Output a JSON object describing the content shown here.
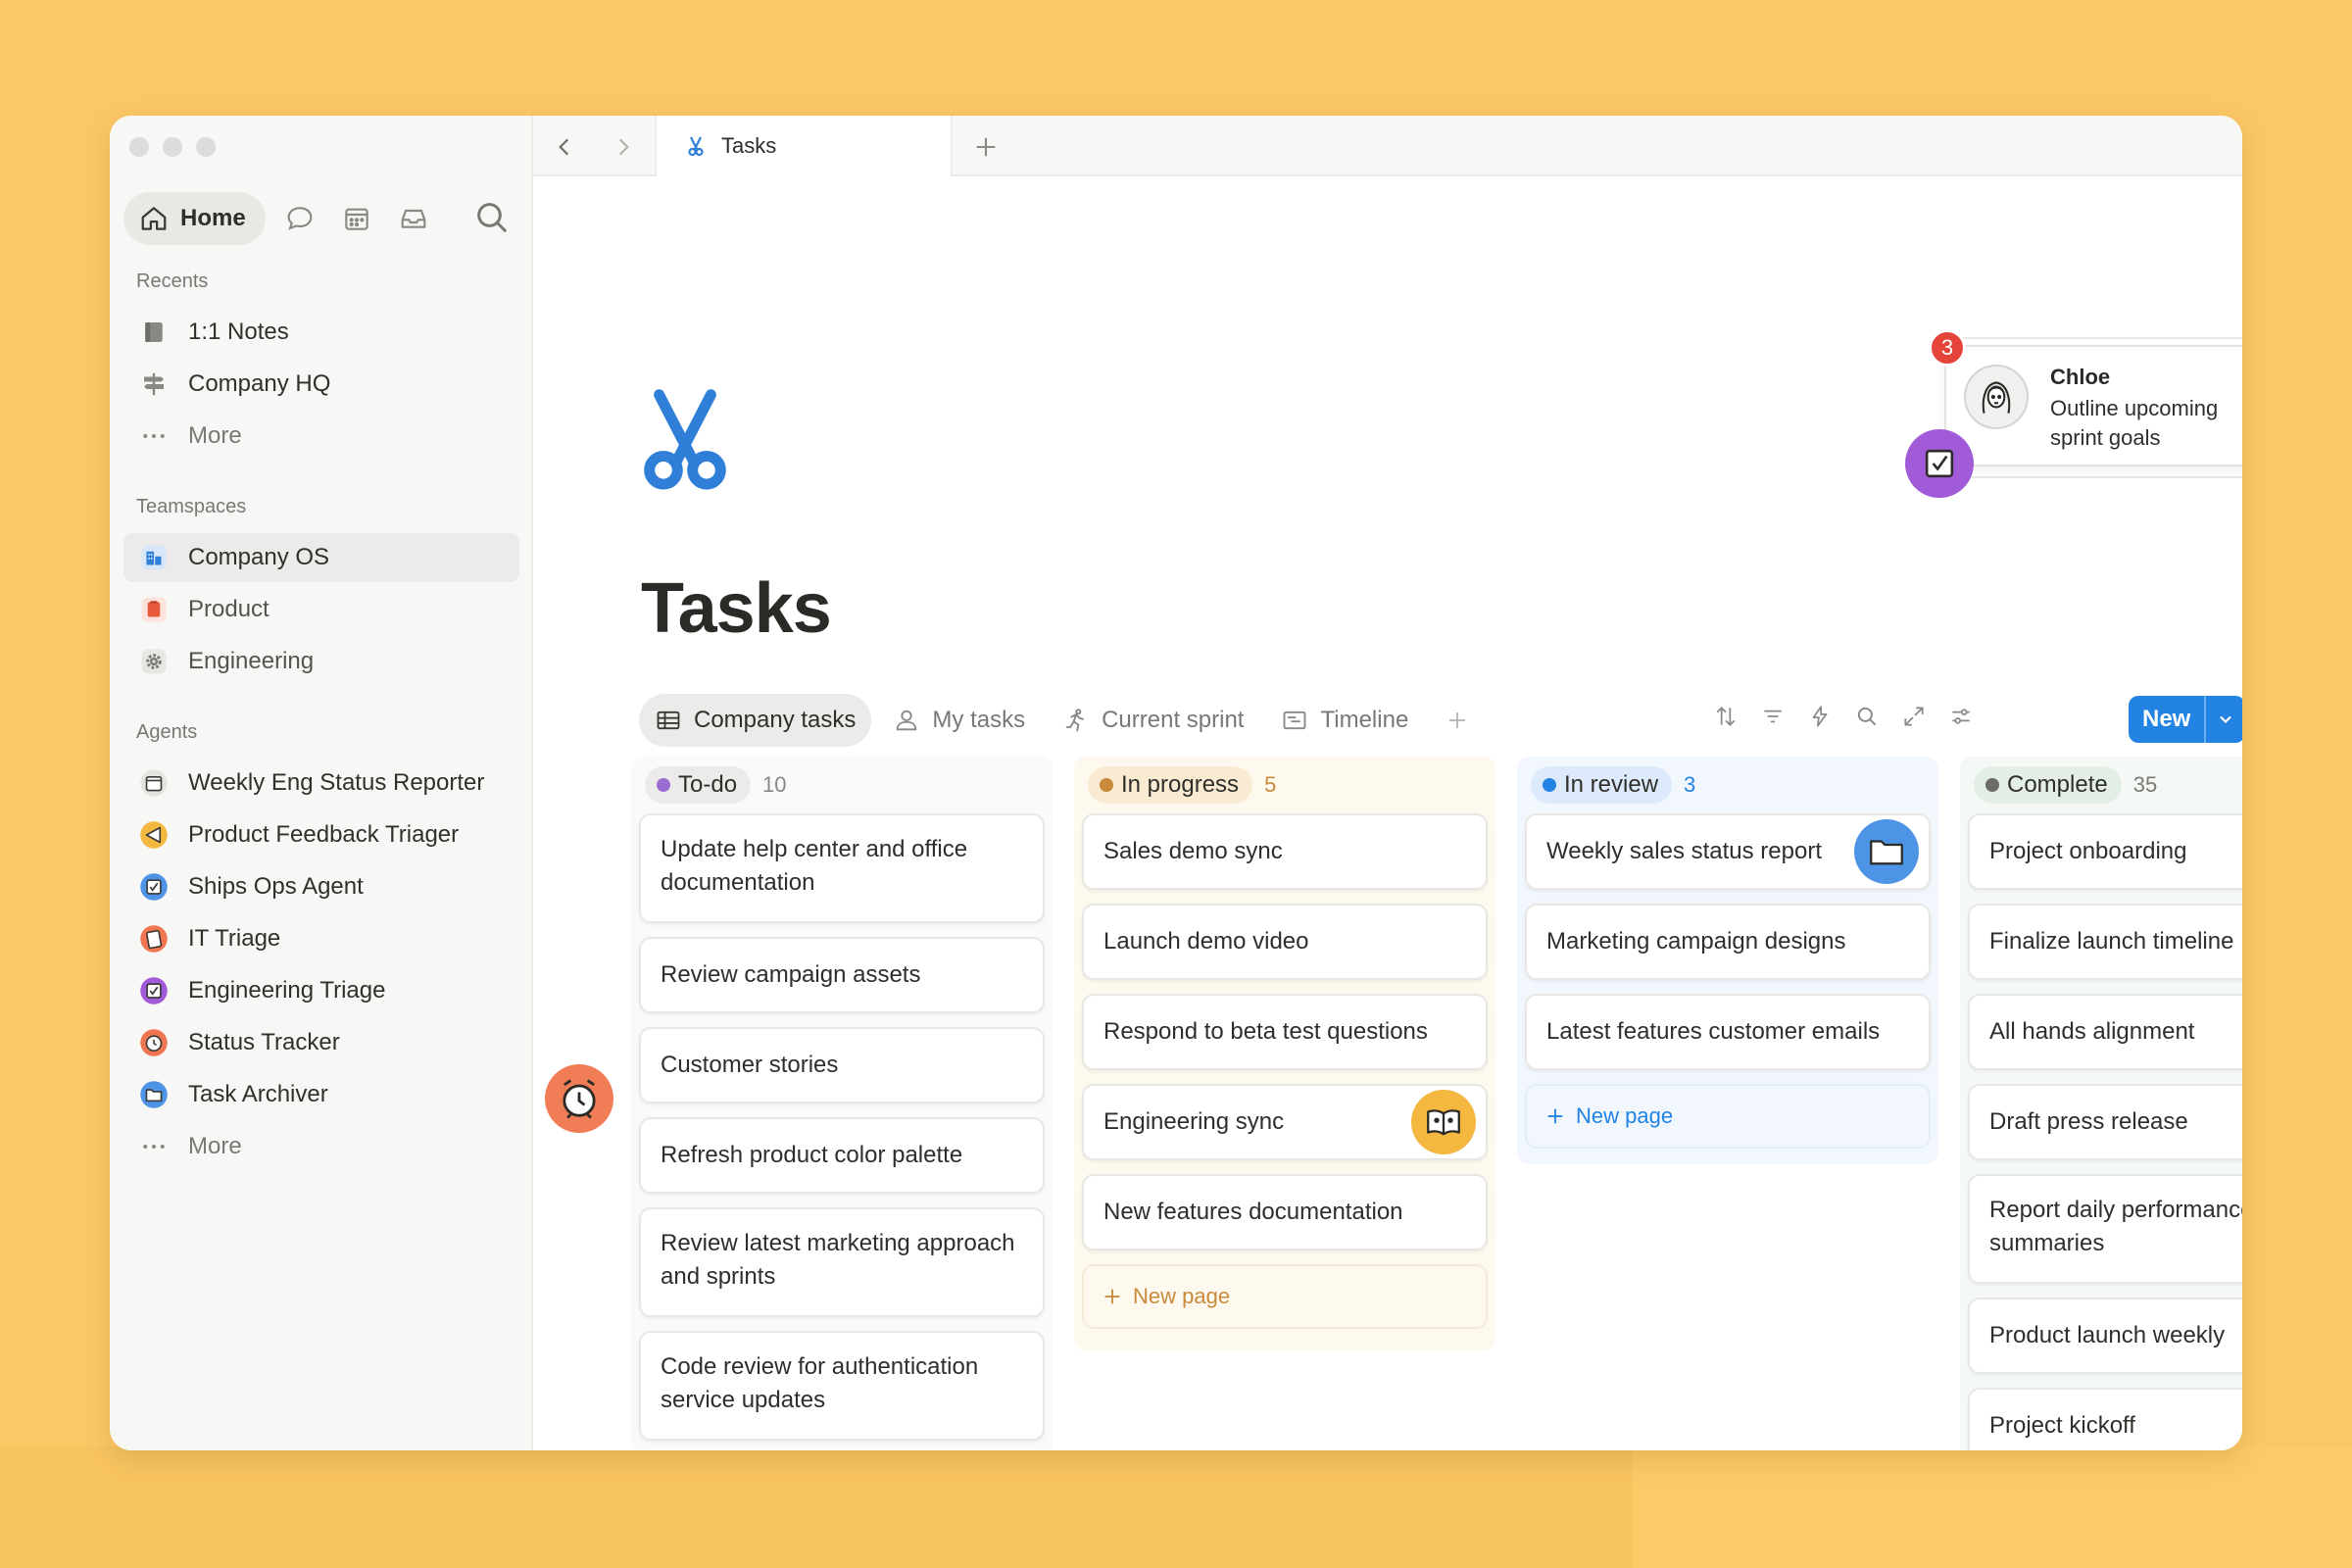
{
  "colors": {
    "accent": "#2383e2",
    "todo": "#9b6dd1",
    "in_progress": "#c88a3b",
    "in_review": "#2383e2",
    "complete": "#6b6b68"
  },
  "sidebar": {
    "home_label": "Home",
    "recents_label": "Recents",
    "recents": [
      {
        "label": "1:1 Notes",
        "icon": "notes-icon"
      },
      {
        "label": "Company HQ",
        "icon": "signpost-icon"
      },
      {
        "label": "More",
        "icon": "more-icon"
      }
    ],
    "teamspaces_label": "Teamspaces",
    "teamspaces": [
      {
        "label": "Company OS",
        "icon": "building-icon"
      },
      {
        "label": "Product",
        "icon": "product-icon"
      },
      {
        "label": "Engineering",
        "icon": "gear-icon"
      }
    ],
    "agents_label": "Agents",
    "agents": [
      {
        "label": "Weekly Eng Status Reporter",
        "icon": "calendar-agent-icon"
      },
      {
        "label": "Product Feedback Triager",
        "icon": "megaphone-agent-icon"
      },
      {
        "label": "Ships Ops Agent",
        "icon": "checkbox-agent-icon"
      },
      {
        "label": "IT Triage",
        "icon": "clipboard-agent-icon"
      },
      {
        "label": "Engineering Triage",
        "icon": "checkbox-agent-icon"
      },
      {
        "label": "Status Tracker",
        "icon": "clock-agent-icon"
      },
      {
        "label": "Task Archiver",
        "icon": "folder-agent-icon"
      },
      {
        "label": "More",
        "icon": "more-icon"
      }
    ]
  },
  "tabbar": {
    "active_tab": "Tasks"
  },
  "page": {
    "title": "Tasks",
    "views": [
      {
        "label": "Company tasks",
        "icon": "table-icon"
      },
      {
        "label": "My tasks",
        "icon": "person-icon"
      },
      {
        "label": "Current sprint",
        "icon": "runner-icon"
      },
      {
        "label": "Timeline",
        "icon": "timeline-icon"
      }
    ],
    "new_label": "New"
  },
  "board": {
    "columns": [
      {
        "status": "To-do",
        "count": "10",
        "cards": [
          "Update help center and office documentation",
          "Review campaign assets",
          "Customer stories",
          "Refresh product color palette",
          "Review latest marketing approach and sprints",
          "Code review for authentication service updates"
        ]
      },
      {
        "status": "In progress",
        "count": "5",
        "cards": [
          "Sales demo sync",
          "Launch demo video",
          "Respond to beta test questions",
          "Engineering sync",
          "New features documentation"
        ],
        "new_page": "New page"
      },
      {
        "status": "In review",
        "count": "3",
        "cards": [
          "Weekly sales status report",
          "Marketing campaign designs",
          "Latest features customer emails"
        ],
        "new_page": "New page"
      },
      {
        "status": "Complete",
        "count": "35",
        "cards": [
          "Project onboarding",
          "Finalize launch timeline",
          "All hands alignment",
          "Draft press release",
          "Report daily performance summaries",
          "Product launch weekly",
          "Project kickoff"
        ]
      }
    ]
  },
  "notification": {
    "count": "3",
    "name": "Chloe",
    "message": "Outline upcoming sprint goals"
  }
}
